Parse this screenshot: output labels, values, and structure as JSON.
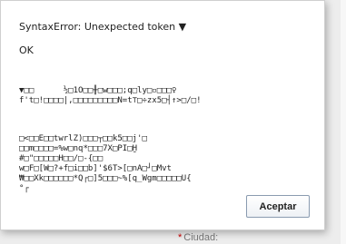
{
  "dialog": {
    "title": "SyntaxError: Unexpected token ▼",
    "status": "OK",
    "paragraphs": [
      "▼□□      ½□1O□□╫□w□□□;q□ly□▫□□□♀\nf't□!□□□□|,□□□□□□□□□N=t⊤□÷zx5□┤↑>□/□!",
      "□<□□E□□twrlZ)□□□┬□□k5□□j'□\n□□m□□□□=%w□nq*□□□7X□PI□Ḫ\n#□\"□□□□□H□□/□-{□□\nw□F□[W□?+f□i□□b]'$6T>[□nA□┘□Mvt\n₩□□Xk□□□□□□*Q┌□]5□□□~%[q_Wgm□□□□□U{\n°┌"
    ],
    "accept_label": "Aceptar"
  },
  "background": {
    "required_marker": "*",
    "field_label": "Ciudad:"
  }
}
